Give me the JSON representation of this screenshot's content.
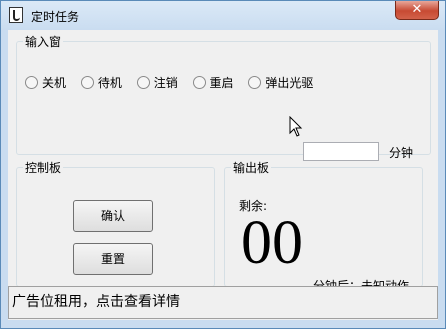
{
  "window": {
    "title": "定时任务",
    "close_symbol": "✕",
    "icon": "app-icon"
  },
  "input_group": {
    "legend": "输入窗",
    "radio_options": [
      "关机",
      "待机",
      "注销",
      "重启",
      "弹出光驱"
    ],
    "minutes_value": "",
    "minutes_label": "分钟"
  },
  "control_group": {
    "legend": "控制板",
    "confirm_label": "确认",
    "reset_label": "重置"
  },
  "output_group": {
    "legend": "输出板",
    "remaining_label": "剩余:",
    "countdown": "00",
    "status_text": "分钟后：未知动作"
  },
  "ad_text": "广告位租用，点击查看详情",
  "colors": {
    "close_button": "#c74a33",
    "title_bar": "#c9dcf0",
    "client_bg": "#f0f0f0"
  }
}
